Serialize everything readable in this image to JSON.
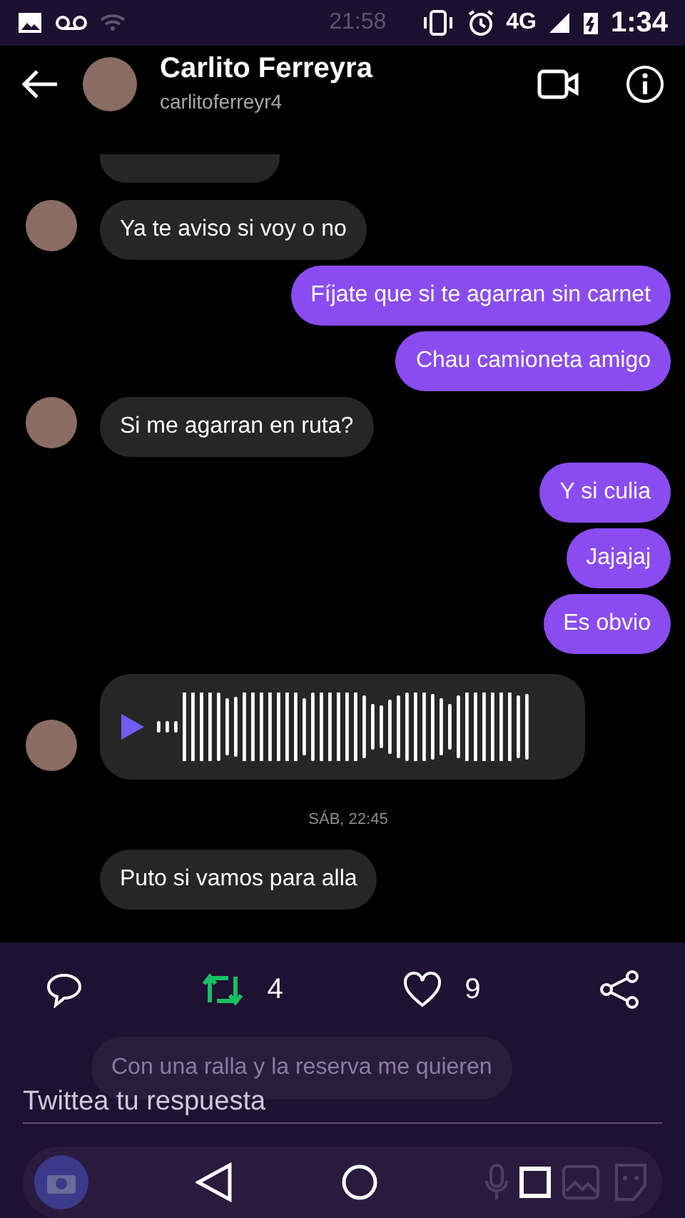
{
  "status_bar": {
    "background_time": "21:58",
    "network": "4G",
    "time": "1:34"
  },
  "header": {
    "name": "Carlito Ferreyra",
    "username": "carlitoferreyr4"
  },
  "messages": [
    {
      "kind": "partial",
      "outgoing": false,
      "avatar": false
    },
    {
      "kind": "text",
      "outgoing": false,
      "avatar": true,
      "text": "Ya te aviso si voy o no"
    },
    {
      "kind": "text",
      "outgoing": true,
      "text": "Fíjate que si te agarran sin carnet"
    },
    {
      "kind": "text",
      "outgoing": true,
      "text": "Chau camioneta amigo"
    },
    {
      "kind": "text",
      "outgoing": false,
      "avatar": true,
      "text": "Si me agarran en ruta?"
    },
    {
      "kind": "text",
      "outgoing": true,
      "text": "Y si culia"
    },
    {
      "kind": "text",
      "outgoing": true,
      "text": "Jajajaj"
    },
    {
      "kind": "text",
      "outgoing": true,
      "text": "Es obvio"
    },
    {
      "kind": "voice",
      "outgoing": false,
      "avatar": true
    },
    {
      "kind": "timestamp",
      "text": "SÁB, 22:45"
    },
    {
      "kind": "text",
      "outgoing": false,
      "avatar": false,
      "text": "Puto si vamos para alla"
    }
  ],
  "overlay": {
    "retweeted": true,
    "retweets": "4",
    "liked": false,
    "likes": "9",
    "ghost_message": "Con una ralla  y la reserva me quieren",
    "reply_placeholder": "Twittea tu respuesta"
  }
}
